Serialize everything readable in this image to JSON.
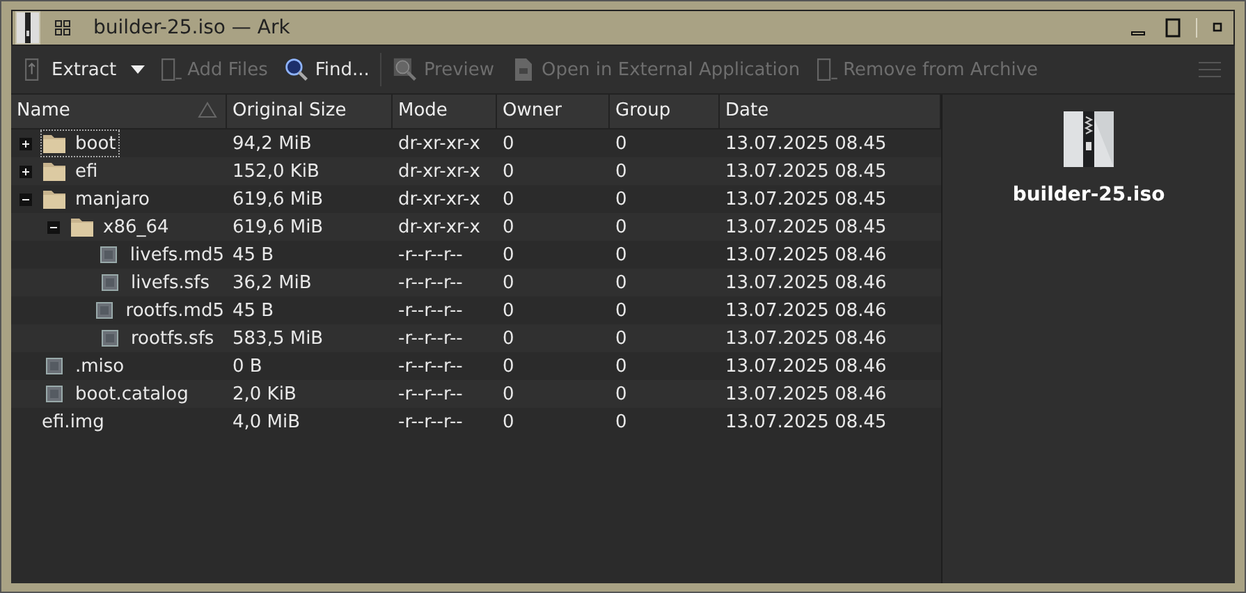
{
  "window": {
    "title": "builder-25.iso — Ark"
  },
  "toolbar": [
    {
      "label": "Extract",
      "disabled": false,
      "kind": "extract",
      "dropdown": true
    },
    {
      "label": "Add Files",
      "disabled": true,
      "kind": "add"
    },
    {
      "label": "Find...",
      "disabled": false,
      "kind": "find"
    },
    {
      "label": "Preview",
      "disabled": true,
      "kind": "preview"
    },
    {
      "label": "Open in External Application",
      "disabled": true,
      "kind": "open"
    },
    {
      "label": "Remove from Archive",
      "disabled": true,
      "kind": "remove"
    }
  ],
  "table": {
    "columns": [
      "Name",
      "Original Size",
      "Mode",
      "Owner",
      "Group",
      "Date"
    ],
    "rows": [
      {
        "name": "boot",
        "kind": "folder",
        "expanded": false,
        "focused": true,
        "size": "94,2 MiB",
        "mode": "dr-xr-xr-x",
        "owner": "0",
        "group": "0",
        "date": "13.07.2025 08.45"
      },
      {
        "name": "efi",
        "kind": "folder",
        "expanded": false,
        "focused": false,
        "size": "152,0 KiB",
        "mode": "dr-xr-xr-x",
        "owner": "0",
        "group": "0",
        "date": "13.07.2025 08.45"
      },
      {
        "name": "manjaro",
        "kind": "folder",
        "expanded": true,
        "focused": false,
        "size": "619,6 MiB",
        "mode": "dr-xr-xr-x",
        "owner": "0",
        "group": "0",
        "date": "13.07.2025 08.45",
        "children": [
          {
            "name": "x86_64",
            "kind": "folder",
            "expanded": true,
            "focused": false,
            "size": "619,6 MiB",
            "mode": "dr-xr-xr-x",
            "owner": "0",
            "group": "0",
            "date": "13.07.2025 08.45",
            "children": [
              {
                "name": "livefs.md5",
                "kind": "file",
                "focused": false,
                "size": "45 B",
                "mode": "-r--r--r--",
                "owner": "0",
                "group": "0",
                "date": "13.07.2025 08.46"
              },
              {
                "name": "livefs.sfs",
                "kind": "file",
                "focused": false,
                "size": "36,2 MiB",
                "mode": "-r--r--r--",
                "owner": "0",
                "group": "0",
                "date": "13.07.2025 08.46"
              },
              {
                "name": "rootfs.md5",
                "kind": "file",
                "focused": false,
                "size": "45 B",
                "mode": "-r--r--r--",
                "owner": "0",
                "group": "0",
                "date": "13.07.2025 08.46"
              },
              {
                "name": "rootfs.sfs",
                "kind": "file",
                "focused": false,
                "size": "583,5 MiB",
                "mode": "-r--r--r--",
                "owner": "0",
                "group": "0",
                "date": "13.07.2025 08.46"
              }
            ]
          }
        ]
      },
      {
        "name": ".miso",
        "kind": "file",
        "focused": false,
        "size": "0 B",
        "mode": "-r--r--r--",
        "owner": "0",
        "group": "0",
        "date": "13.07.2025 08.46"
      },
      {
        "name": "boot.catalog",
        "kind": "file",
        "focused": false,
        "size": "2,0 KiB",
        "mode": "-r--r--r--",
        "owner": "0",
        "group": "0",
        "date": "13.07.2025 08.46"
      },
      {
        "name": "efi.img",
        "kind": "bare",
        "focused": false,
        "size": "4,0 MiB",
        "mode": "-r--r--r--",
        "owner": "0",
        "group": "0",
        "date": "13.07.2025 08.45"
      }
    ]
  },
  "info_panel": {
    "name": "builder-25.iso"
  }
}
